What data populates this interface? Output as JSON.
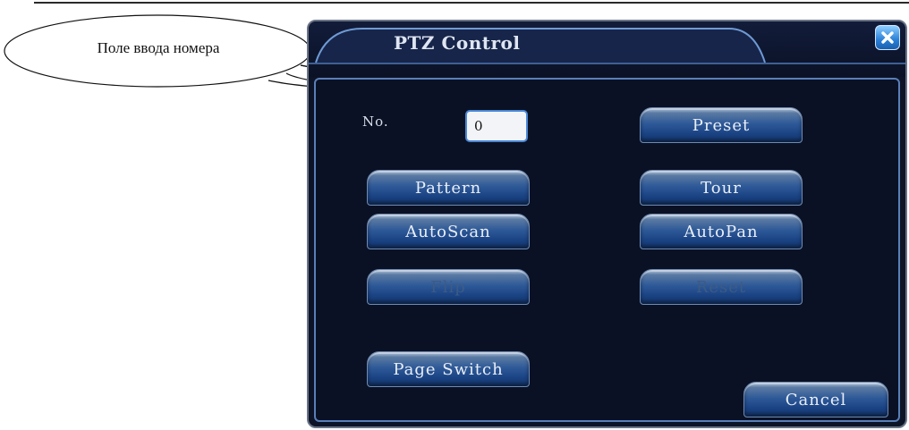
{
  "callout": {
    "text": "Поле ввода номера"
  },
  "dialog": {
    "title": "PTZ Control",
    "no_label": "No.",
    "no_value": "0",
    "buttons": {
      "preset": "Preset",
      "pattern": "Pattern",
      "tour": "Tour",
      "autoscan": "AutoScan",
      "autopan": "AutoPan",
      "flip": "Flip",
      "reset": "Reset",
      "page_switch": "Page Switch",
      "cancel": "Cancel"
    },
    "disabled": [
      "Flip",
      "Reset"
    ]
  },
  "icons": {
    "close": "close-icon"
  },
  "colors": {
    "background": "#0d1428",
    "accent": "#4a87d6",
    "close_button": "#2a7fd6"
  }
}
